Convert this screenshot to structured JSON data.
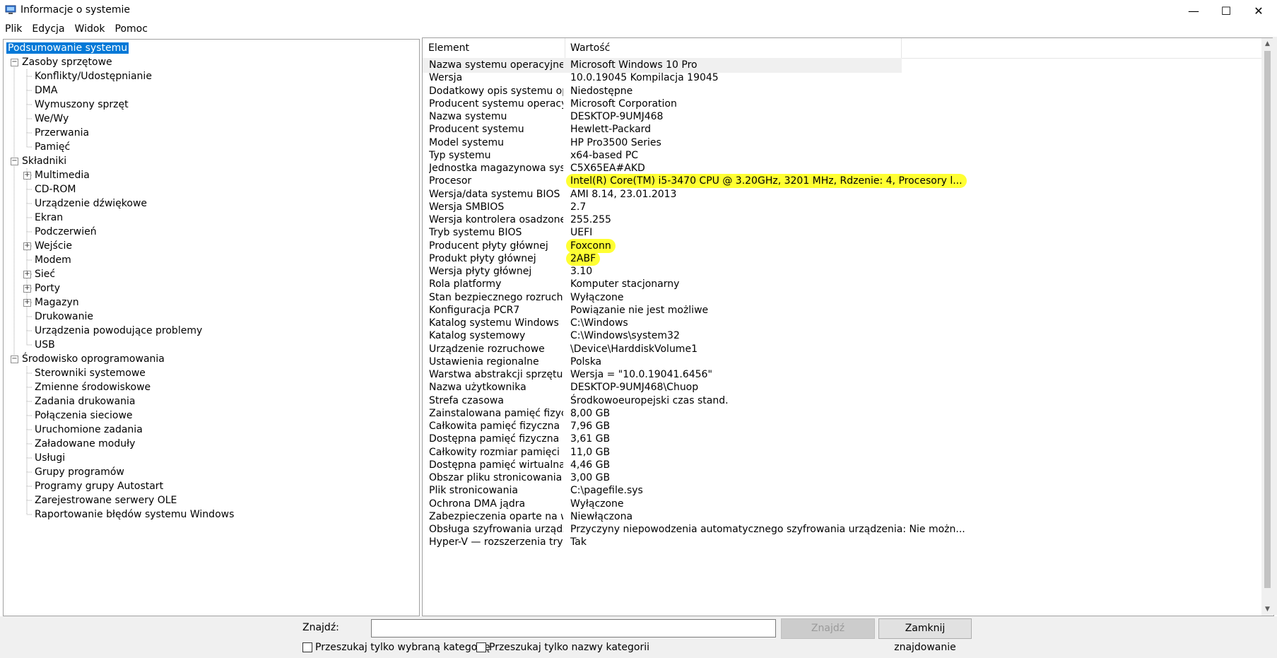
{
  "window": {
    "title": "Informacje o systemie",
    "minimize_glyph": "—",
    "maximize_glyph": "☐",
    "close_glyph": "✕"
  },
  "menu": [
    "Plik",
    "Edycja",
    "Widok",
    "Pomoc"
  ],
  "tree": [
    {
      "label": "Podsumowanie systemu",
      "level": 0,
      "expander": "none",
      "selected": true
    },
    {
      "label": "Zasoby sprzętowe",
      "level": 0,
      "expander": "minus"
    },
    {
      "label": "Konflikty/Udostępnianie",
      "level": 1,
      "expander": "none"
    },
    {
      "label": "DMA",
      "level": 1,
      "expander": "none"
    },
    {
      "label": "Wymuszony sprzęt",
      "level": 1,
      "expander": "none"
    },
    {
      "label": "We/Wy",
      "level": 1,
      "expander": "none"
    },
    {
      "label": "Przerwania",
      "level": 1,
      "expander": "none"
    },
    {
      "label": "Pamięć",
      "level": 1,
      "expander": "none"
    },
    {
      "label": "Składniki",
      "level": 0,
      "expander": "minus"
    },
    {
      "label": "Multimedia",
      "level": 1,
      "expander": "plus"
    },
    {
      "label": "CD-ROM",
      "level": 1,
      "expander": "none"
    },
    {
      "label": "Urządzenie dźwiękowe",
      "level": 1,
      "expander": "none"
    },
    {
      "label": "Ekran",
      "level": 1,
      "expander": "none"
    },
    {
      "label": "Podczerwień",
      "level": 1,
      "expander": "none"
    },
    {
      "label": "Wejście",
      "level": 1,
      "expander": "plus"
    },
    {
      "label": "Modem",
      "level": 1,
      "expander": "none"
    },
    {
      "label": "Sieć",
      "level": 1,
      "expander": "plus"
    },
    {
      "label": "Porty",
      "level": 1,
      "expander": "plus"
    },
    {
      "label": "Magazyn",
      "level": 1,
      "expander": "plus"
    },
    {
      "label": "Drukowanie",
      "level": 1,
      "expander": "none"
    },
    {
      "label": "Urządzenia powodujące problemy",
      "level": 1,
      "expander": "none"
    },
    {
      "label": "USB",
      "level": 1,
      "expander": "none"
    },
    {
      "label": "Środowisko oprogramowania",
      "level": 0,
      "expander": "minus"
    },
    {
      "label": "Sterowniki systemowe",
      "level": 1,
      "expander": "none"
    },
    {
      "label": "Zmienne środowiskowe",
      "level": 1,
      "expander": "none"
    },
    {
      "label": "Zadania drukowania",
      "level": 1,
      "expander": "none"
    },
    {
      "label": "Połączenia sieciowe",
      "level": 1,
      "expander": "none"
    },
    {
      "label": "Uruchomione zadania",
      "level": 1,
      "expander": "none"
    },
    {
      "label": "Załadowane moduły",
      "level": 1,
      "expander": "none"
    },
    {
      "label": "Usługi",
      "level": 1,
      "expander": "none"
    },
    {
      "label": "Grupy programów",
      "level": 1,
      "expander": "none"
    },
    {
      "label": "Programy grupy Autostart",
      "level": 1,
      "expander": "none"
    },
    {
      "label": "Zarejestrowane serwery OLE",
      "level": 1,
      "expander": "none"
    },
    {
      "label": "Raportowanie błędów systemu Windows",
      "level": 1,
      "expander": "none"
    }
  ],
  "table": {
    "columns": [
      "Element",
      "Wartość"
    ],
    "rows": [
      {
        "element": "Nazwa systemu operacyjnego",
        "value": "Microsoft Windows 10 Pro"
      },
      {
        "element": "Wersja",
        "value": "10.0.19045 Kompilacja 19045"
      },
      {
        "element": "Dodatkowy opis systemu oper...",
        "value": "Niedostępne"
      },
      {
        "element": "Producent systemu operacyjne...",
        "value": "Microsoft Corporation"
      },
      {
        "element": "Nazwa systemu",
        "value": "DESKTOP-9UMJ468"
      },
      {
        "element": "Producent systemu",
        "value": "Hewlett-Packard"
      },
      {
        "element": "Model systemu",
        "value": "HP Pro3500 Series"
      },
      {
        "element": "Typ systemu",
        "value": "x64-based PC"
      },
      {
        "element": "Jednostka magazynowa systemu",
        "value": "C5X65EA#AKD"
      },
      {
        "element": "Procesor",
        "value": "Intel(R) Core(TM) i5-3470 CPU @ 3.20GHz, 3201 MHz, Rdzenie: 4, Procesory l...",
        "highlight": true
      },
      {
        "element": "Wersja/data systemu BIOS",
        "value": "AMI 8.14, 23.01.2013"
      },
      {
        "element": "Wersja SMBIOS",
        "value": "2.7"
      },
      {
        "element": "Wersja kontrolera osadzonego",
        "value": "255.255"
      },
      {
        "element": "Tryb systemu BIOS",
        "value": "UEFI"
      },
      {
        "element": "Producent płyty głównej",
        "value": "Foxconn",
        "highlight": true
      },
      {
        "element": "Produkt płyty głównej",
        "value": "2ABF",
        "highlight": true
      },
      {
        "element": "Wersja płyty głównej",
        "value": "3.10"
      },
      {
        "element": "Rola platformy",
        "value": "Komputer stacjonarny"
      },
      {
        "element": "Stan bezpiecznego rozruchu",
        "value": "Wyłączone"
      },
      {
        "element": "Konfiguracja PCR7",
        "value": "Powiązanie nie jest możliwe"
      },
      {
        "element": "Katalog systemu Windows",
        "value": "C:\\Windows"
      },
      {
        "element": "Katalog systemowy",
        "value": "C:\\Windows\\system32"
      },
      {
        "element": "Urządzenie rozruchowe",
        "value": "\\Device\\HarddiskVolume1"
      },
      {
        "element": "Ustawienia regionalne",
        "value": "Polska"
      },
      {
        "element": "Warstwa abstrakcji sprzętu",
        "value": "Wersja = \"10.0.19041.6456\""
      },
      {
        "element": "Nazwa użytkownika",
        "value": "DESKTOP-9UMJ468\\Chuop"
      },
      {
        "element": "Strefa czasowa",
        "value": "Środkowoeuropejski czas stand."
      },
      {
        "element": "Zainstalowana pamięć fizyczna ...",
        "value": "8,00 GB"
      },
      {
        "element": "Całkowita pamięć fizyczna",
        "value": "7,96 GB"
      },
      {
        "element": "Dostępna pamięć fizyczna",
        "value": "3,61 GB"
      },
      {
        "element": "Całkowity rozmiar pamięci wirt...",
        "value": "11,0 GB"
      },
      {
        "element": "Dostępna pamięć wirtualna",
        "value": "4,46 GB"
      },
      {
        "element": "Obszar pliku stronicowania",
        "value": "3,00 GB"
      },
      {
        "element": "Plik stronicowania",
        "value": "C:\\pagefile.sys"
      },
      {
        "element": "Ochrona DMA jądra",
        "value": "Wyłączone"
      },
      {
        "element": "Zabezpieczenia oparte na wirtu...",
        "value": "Niewłączona"
      },
      {
        "element": "Obsługa szyfrowania urządzeń",
        "value": "Przyczyny niepowodzenia automatycznego szyfrowania urządzenia: Nie możn..."
      },
      {
        "element": "Hyper-V — rozszerzenia trybu ...",
        "value": "Tak"
      }
    ]
  },
  "find": {
    "label": "Znajdź:",
    "input_value": "",
    "find_button": "Znajdź",
    "close_button": "Zamknij znajdowanie",
    "checkbox_category": "Przeszukaj tylko wybraną kategorię",
    "checkbox_names": "Przeszukaj tylko nazwy kategorii"
  },
  "colors": {
    "selection": "#0078d7",
    "highlight": "#ffff33"
  }
}
